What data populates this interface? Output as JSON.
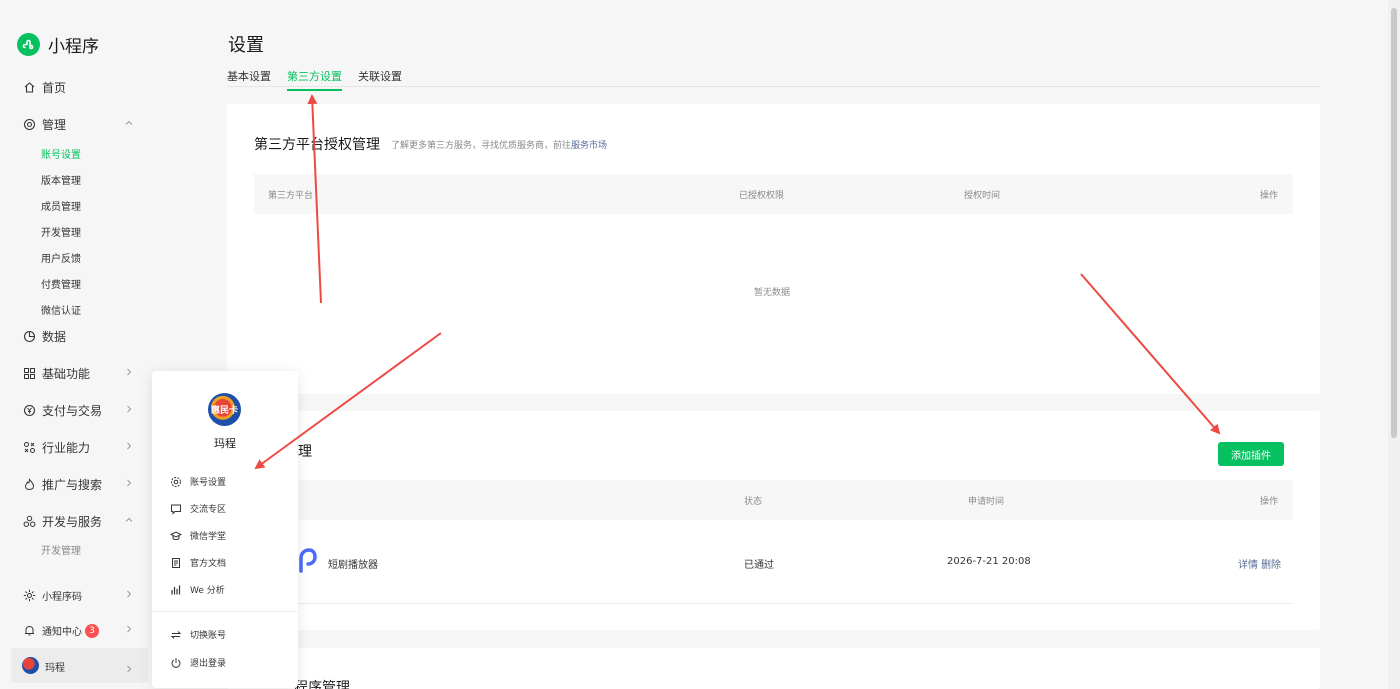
{
  "brand": {
    "name": "小程序"
  },
  "sidebar": {
    "home": "首页",
    "manage": "管理",
    "manage_items": [
      "账号设置",
      "版本管理",
      "成员管理",
      "开发管理",
      "用户反馈",
      "付费管理",
      "微信认证"
    ],
    "data": "数据",
    "basic": "基础功能",
    "payment": "支付与交易",
    "industry": "行业能力",
    "promo": "推广与搜索",
    "devservice": "开发与服务",
    "devservice_items": [
      "开发管理"
    ],
    "qrcode": "小程序码",
    "notify": "通知中心",
    "notify_count": "3",
    "user": "玛程"
  },
  "page": {
    "title": "设置",
    "tabs": [
      "基本设置",
      "第三方设置",
      "关联设置"
    ]
  },
  "auth_card": {
    "title": "第三方平台授权管理",
    "hint": "了解更多第三方服务，寻找优质服务商，前往",
    "hint_link": "服务市场",
    "columns": [
      "第三方平台",
      "已授权权限",
      "授权时间",
      "操作"
    ],
    "empty": "暂无数据"
  },
  "plugin_card": {
    "title_partial": "理",
    "add_button": "添加插件",
    "columns": [
      "状态",
      "申请时间",
      "操作"
    ],
    "rows": [
      {
        "name": "短剧播放器",
        "status": "已通过",
        "time": "2026-7-21 20:08",
        "action_detail": "详情",
        "action_delete": "删除"
      }
    ]
  },
  "third_card": {
    "title_partial": "程序管理"
  },
  "popup": {
    "avatar_text": "惠民卡",
    "name": "玛程",
    "items": [
      "账号设置",
      "交流专区",
      "微信学堂",
      "官方文档",
      "We 分析"
    ],
    "items2": [
      "切换账号",
      "退出登录"
    ]
  },
  "colors": {
    "accent": "#07c160",
    "link": "#576b95",
    "badge": "#fa5151",
    "arrow": "#ee4a44"
  }
}
